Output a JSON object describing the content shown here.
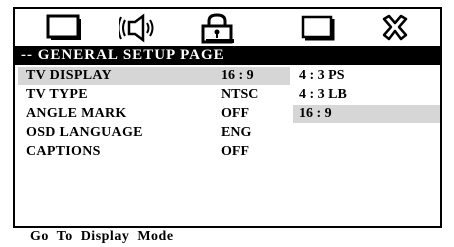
{
  "tabs": [
    {
      "name": "tv-icon"
    },
    {
      "name": "speaker-icon"
    },
    {
      "name": "lock-icon"
    },
    {
      "name": "screen-icon"
    },
    {
      "name": "exit-icon"
    }
  ],
  "page_title": "-- GENERAL SETUP PAGE",
  "settings": [
    {
      "label": "TV DISPLAY",
      "value": "16 : 9"
    },
    {
      "label": "TV TYPE",
      "value": "NTSC"
    },
    {
      "label": "ANGLE MARK",
      "value": "OFF"
    },
    {
      "label": "OSD LANGUAGE",
      "value": "ENG"
    },
    {
      "label": "CAPTIONS",
      "value": "OFF"
    }
  ],
  "selected_setting": "TV DISPLAY",
  "options": [
    "4 : 3 PS",
    "4 : 3 LB",
    "16 : 9"
  ],
  "selected_option": "16 : 9",
  "status_text": "Go  To  Display  Mode",
  "colors": {
    "highlight": "#d6d6d6",
    "title_bar": "#000000"
  }
}
